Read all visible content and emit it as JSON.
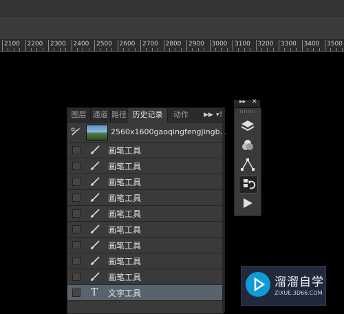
{
  "ruler": {
    "labels": [
      "2100",
      "2200",
      "2300",
      "2400",
      "2500",
      "2600",
      "2700",
      "2800",
      "2900",
      "3000",
      "3100",
      "3200",
      "3300",
      "3400",
      "3500"
    ]
  },
  "panel": {
    "tabs": [
      "图层",
      "通道",
      "路径",
      "历史记录",
      "动作"
    ],
    "active_tab": "历史记录",
    "snapshot": {
      "label": "2560x1600gaoqingfengjingb..."
    },
    "history_items": [
      {
        "label": "画笔工具",
        "icon": "brush-icon",
        "selected": false
      },
      {
        "label": "画笔工具",
        "icon": "brush-icon",
        "selected": false
      },
      {
        "label": "画笔工具",
        "icon": "brush-icon",
        "selected": false
      },
      {
        "label": "画笔工具",
        "icon": "brush-icon",
        "selected": false
      },
      {
        "label": "画笔工具",
        "icon": "brush-icon",
        "selected": false
      },
      {
        "label": "画笔工具",
        "icon": "brush-icon",
        "selected": false
      },
      {
        "label": "画笔工具",
        "icon": "brush-icon",
        "selected": false
      },
      {
        "label": "画笔工具",
        "icon": "brush-icon",
        "selected": false
      },
      {
        "label": "画笔工具",
        "icon": "brush-icon",
        "selected": false
      },
      {
        "label": "文字工具",
        "icon": "text-tool-icon",
        "selected": true
      }
    ]
  },
  "tool_strip": {
    "buttons": [
      "layers-icon",
      "channels-icon",
      "paths-icon",
      "history-icon",
      "actions-play-icon"
    ],
    "active": "history-icon"
  },
  "watermark": {
    "title": "溜溜自学",
    "subtitle": "ZIXUE.3D66.COM"
  },
  "colors": {
    "background": "#000000",
    "panel": "#3a3a3a",
    "selected_row": "#59636d",
    "watermark_accent": "#0f9bd6"
  }
}
